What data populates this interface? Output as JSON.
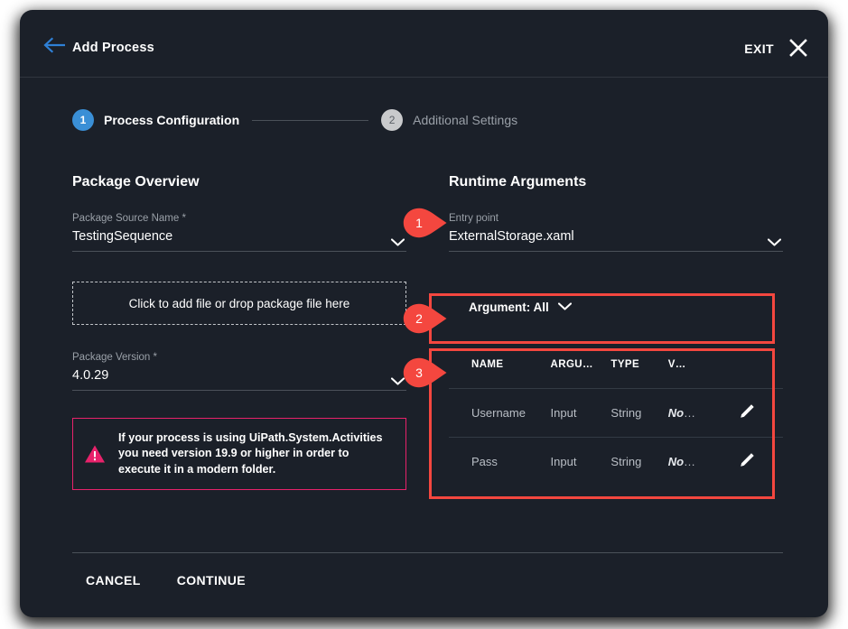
{
  "header": {
    "title": "Add Process",
    "back_icon": "arrow-left-icon",
    "exit_label": "EXIT",
    "close_icon": "close-x-icon"
  },
  "stepper": {
    "steps": [
      {
        "number": "1",
        "label": "Process Configuration",
        "state": "active"
      },
      {
        "number": "2",
        "label": "Additional Settings",
        "state": "inactive"
      }
    ]
  },
  "package_overview": {
    "title": "Package Overview",
    "source_name": {
      "label": "Package Source Name *",
      "value": "TestingSequence",
      "chevron_icon": "chevron-down-icon"
    },
    "dropzone": {
      "text": "Click to add file or drop package file here"
    },
    "version": {
      "label": "Package Version *",
      "value": "4.0.29",
      "chevron_icon": "chevron-down-icon"
    },
    "warning": {
      "icon": "warning-triangle-icon",
      "text": "If your process is using UiPath.System.Activities you need version 19.9 or higher in order to execute it in a modern folder."
    }
  },
  "runtime_arguments": {
    "title": "Runtime Arguments",
    "entry_point": {
      "label": "Entry point",
      "value": "ExternalStorage.xaml",
      "chevron_icon": "chevron-down-icon"
    },
    "filter": {
      "label": "Argument: All",
      "chevron_icon": "chevron-down-icon"
    },
    "table": {
      "columns": [
        "NAME",
        "ARGU…",
        "TYPE",
        "V…",
        ""
      ],
      "rows": [
        {
          "name": "Username",
          "direction": "Input",
          "type": "String",
          "value": "No",
          "value_ellipsis": "…",
          "edit_icon": "pencil-edit-icon"
        },
        {
          "name": "Pass",
          "direction": "Input",
          "type": "String",
          "value": "No",
          "value_ellipsis": "…",
          "edit_icon": "pencil-edit-icon"
        }
      ]
    }
  },
  "callouts": [
    {
      "number": "1",
      "target": "entry-point-field"
    },
    {
      "number": "2",
      "target": "argument-filter"
    },
    {
      "number": "3",
      "target": "arguments-table"
    }
  ],
  "footer": {
    "cancel_label": "CANCEL",
    "continue_label": "CONTINUE"
  },
  "colors": {
    "panel_bg": "#1b2029",
    "accent_blue": "#3a8fd6",
    "highlight_red": "#f4473f",
    "warning_pink": "#e8226b",
    "text_primary": "#ffffff",
    "text_muted": "#9aa0a8"
  }
}
